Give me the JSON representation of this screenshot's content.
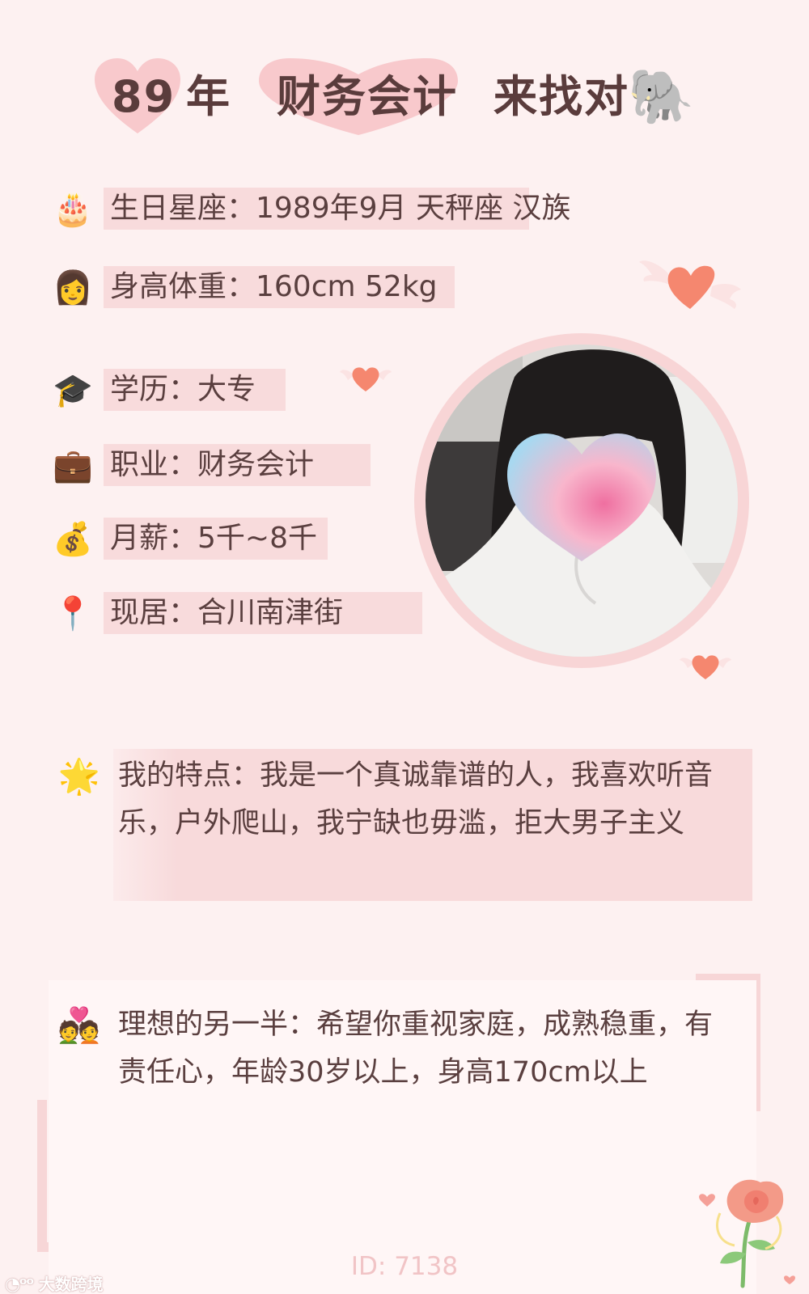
{
  "title": {
    "year": "89",
    "year_suffix": "年",
    "job": "财务会计",
    "slogan": "来找对",
    "slogan_emoji": "🐘"
  },
  "info": [
    {
      "icon": "birthday-cake-icon",
      "glyph": "🎂",
      "text": "生日星座：1989年9月 天秤座 汉族"
    },
    {
      "icon": "woman-icon",
      "glyph": "👩",
      "text": "身高体重：160cm 52kg"
    },
    {
      "icon": "graduation-cap-icon",
      "glyph": "🎓",
      "text": "学历：大专"
    },
    {
      "icon": "briefcase-icon",
      "glyph": "💼",
      "text": "职业：财务会计"
    },
    {
      "icon": "money-bag-icon",
      "glyph": "💰",
      "text": "月薪：5千~8千"
    },
    {
      "icon": "location-pin-icon",
      "glyph": "📍",
      "text": "现居：合川南津街"
    }
  ],
  "features": {
    "icon": "star-icon",
    "glyph": "🌟",
    "line1": "我的特点：我是一个真诚靠谱的人，我喜欢听音",
    "line2": "乐，户外爬山，我宁缺也毋滥，拒大男子主义"
  },
  "ideal": {
    "icon": "couple-heart-icon",
    "glyph": "💑",
    "line1": "理想的另一半：希望你重视家庭，成熟稳重，有",
    "line2": "责任心，年龄30岁以上，身高170cm以上"
  },
  "id_label": "ID: 7138",
  "watermark": "大数跨境",
  "colors": {
    "background": "#fdf1f1",
    "highlight": "#f8dbdc",
    "heart": "#f08a7a",
    "text": "#5a3f3f"
  }
}
